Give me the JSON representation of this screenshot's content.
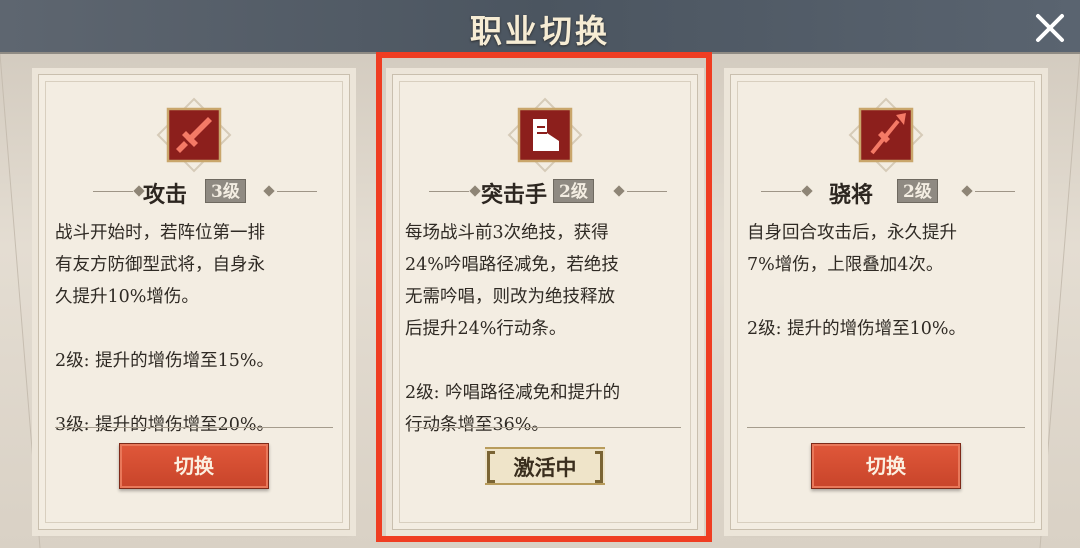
{
  "header": {
    "title": "职业切换"
  },
  "cards": [
    {
      "name": "攻击",
      "level": "3级",
      "description": "战斗开始时，若阵位第一排\n有友方防御型武将，自身永\n久提升10%增伤。\n\n2级: 提升的增伤增至15%。\n\n3级: 提升的增伤增至20%。",
      "button_label": "切换",
      "emblem_icon": "sword-icon"
    },
    {
      "name": "突击手",
      "level": "2级",
      "description": "每场战斗前3次绝技，获得\n24%吟唱路径减免，若绝技\n无需吟唱，则改为绝技释放\n后提升24%行动条。\n\n2级: 吟唱路径减免和提升的\n行动条增至36%。",
      "status_label": "激活中",
      "emblem_icon": "boot-icon"
    },
    {
      "name": "骁将",
      "level": "2级",
      "description": "自身回合攻击后，永久提升\n7%增伤，上限叠加4次。\n\n2级: 提升的增伤增至10%。",
      "button_label": "切换",
      "emblem_icon": "halberd-icon"
    }
  ],
  "colors": {
    "accent_red": "#ef3d22",
    "button_red": "#d04c30",
    "emblem_red": "#8c1f1c",
    "card_bg": "#f3ede2"
  }
}
